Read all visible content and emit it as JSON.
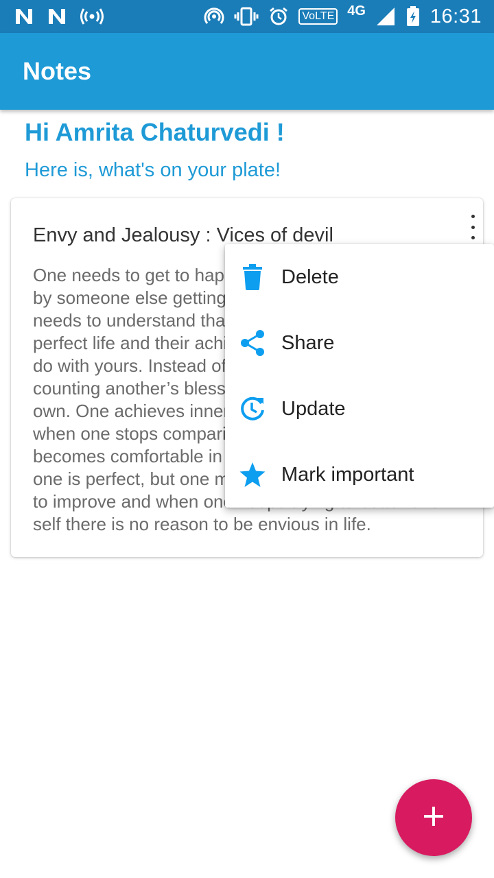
{
  "status_bar": {
    "time": "16:31",
    "network": "4G",
    "volte": "VoLTE",
    "icons": [
      "n-icon",
      "n-icon",
      "hotspot-icon",
      "cast-icon",
      "vibrate-icon",
      "alarm-icon",
      "signal-icon",
      "battery-icon"
    ]
  },
  "app_bar": {
    "title": "Notes"
  },
  "greeting": {
    "title": "Hi Amrita Chaturvedi !",
    "subtitle": "Here is, what's on your plate!"
  },
  "note": {
    "title": "Envy and Jealousy : Vices of devil",
    "body": "One needs to get to happiness and not be bothered by someone else getting attention or success. One needs to understand that someone’s so called perfect life and their achievements have nothing to do with yours. Instead of being envious and counting another’s blessings, one must count one's own. One achieves inner peace and contentment when one stops comparing oneself with others and becomes comfortable in one’s imperfections. No one is perfect, but one must be sincere to work hard to improve and when one keeps trying to better one self there is no reason to be envious in life."
  },
  "menu": {
    "items": [
      {
        "label": "Delete",
        "icon": "trash-icon"
      },
      {
        "label": "Share",
        "icon": "share-icon"
      },
      {
        "label": "Update",
        "icon": "update-icon"
      },
      {
        "label": "Mark important",
        "icon": "star-icon"
      }
    ]
  },
  "fab": {
    "icon": "plus-icon"
  },
  "colors": {
    "status_bar": "#1b7db8",
    "app_bar": "#1e9ad6",
    "accent": "#1e9ad6",
    "menu_icon": "#0d9ef0",
    "fab": "#d81b60"
  }
}
